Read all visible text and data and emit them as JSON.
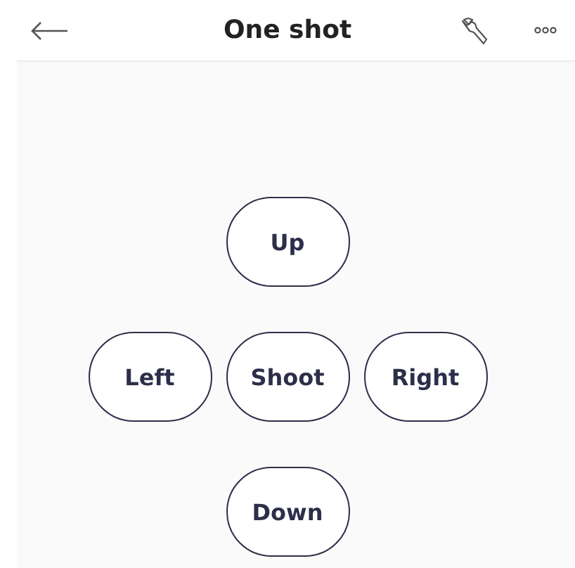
{
  "header": {
    "title": "One shot"
  },
  "pad_rows": [
    {
      "buttons": [
        {
          "label": "Up"
        }
      ]
    },
    {
      "buttons": [
        {
          "label": "Left"
        },
        {
          "label": "Shoot"
        },
        {
          "label": "Right"
        }
      ]
    },
    {
      "buttons": [
        {
          "label": "Down"
        }
      ]
    }
  ]
}
